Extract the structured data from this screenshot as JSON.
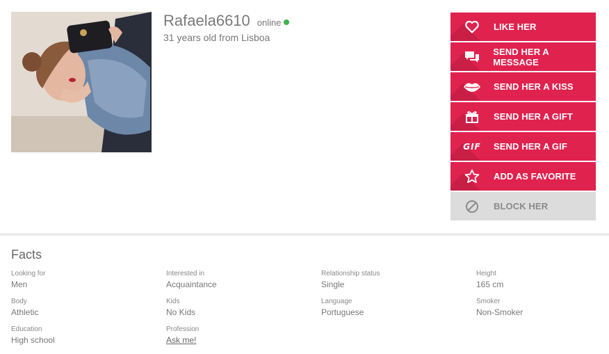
{
  "profile": {
    "username": "Rafaela6610",
    "status": "online",
    "subtitle": "31 years old from Lisboa",
    "status_color": "#3ab54a"
  },
  "actions": [
    {
      "label": "LIKE HER",
      "icon": "heart-icon"
    },
    {
      "label": "SEND HER A MESSAGE",
      "icon": "chat-icon"
    },
    {
      "label": "SEND HER A KISS",
      "icon": "lips-icon"
    },
    {
      "label": "SEND HER A GIFT",
      "icon": "gift-icon"
    },
    {
      "label": "SEND HER A GIF",
      "icon": "gif-icon",
      "icon_text": "GIF"
    },
    {
      "label": "ADD AS FAVORITE",
      "icon": "star-icon"
    },
    {
      "label": "BLOCK HER",
      "icon": "block-icon"
    }
  ],
  "colors": {
    "accent": "#e0224f",
    "disabled": "#dcdcdc"
  },
  "facts": {
    "title": "Facts",
    "items": [
      {
        "key": "Looking for",
        "value": "Men"
      },
      {
        "key": "Interested in",
        "value": "Acquaintance"
      },
      {
        "key": "Relationship status",
        "value": "Single"
      },
      {
        "key": "Height",
        "value": "165 cm"
      },
      {
        "key": "Body",
        "value": "Athletic"
      },
      {
        "key": "Kids",
        "value": "No Kids"
      },
      {
        "key": "Language",
        "value": "Portuguese"
      },
      {
        "key": "Smoker",
        "value": "Non-Smoker"
      },
      {
        "key": "Education",
        "value": "High school"
      },
      {
        "key": "Profession",
        "value": "Ask me!"
      }
    ]
  }
}
